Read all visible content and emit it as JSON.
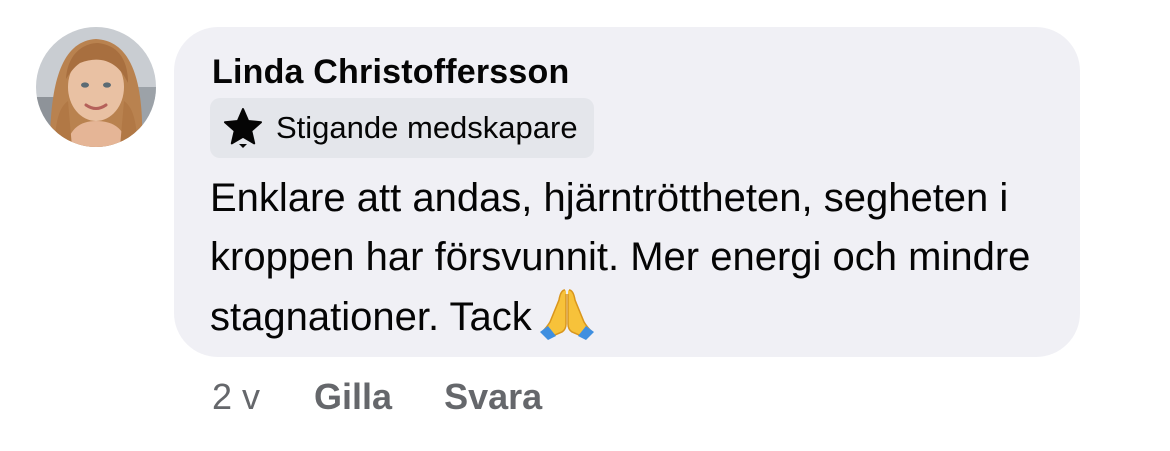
{
  "comment": {
    "author": "Linda Christoffersson",
    "badge": {
      "icon": "star-icon",
      "label": "Stigande medskapare"
    },
    "text": "Enklare att andas, hjärntröttheten, segheten i kroppen har försvunnit. Mer energi och mindre stagnationer. Tack",
    "emoji": "folded-hands-icon",
    "avatar": "profile-photo"
  },
  "actions": {
    "timestamp": "2 v",
    "like_label": "Gilla",
    "reply_label": "Svara"
  },
  "colors": {
    "bubble_background": "#f0f0f5",
    "badge_background": "#e4e6eb",
    "text": "#050505",
    "secondary_text": "#65676b"
  }
}
